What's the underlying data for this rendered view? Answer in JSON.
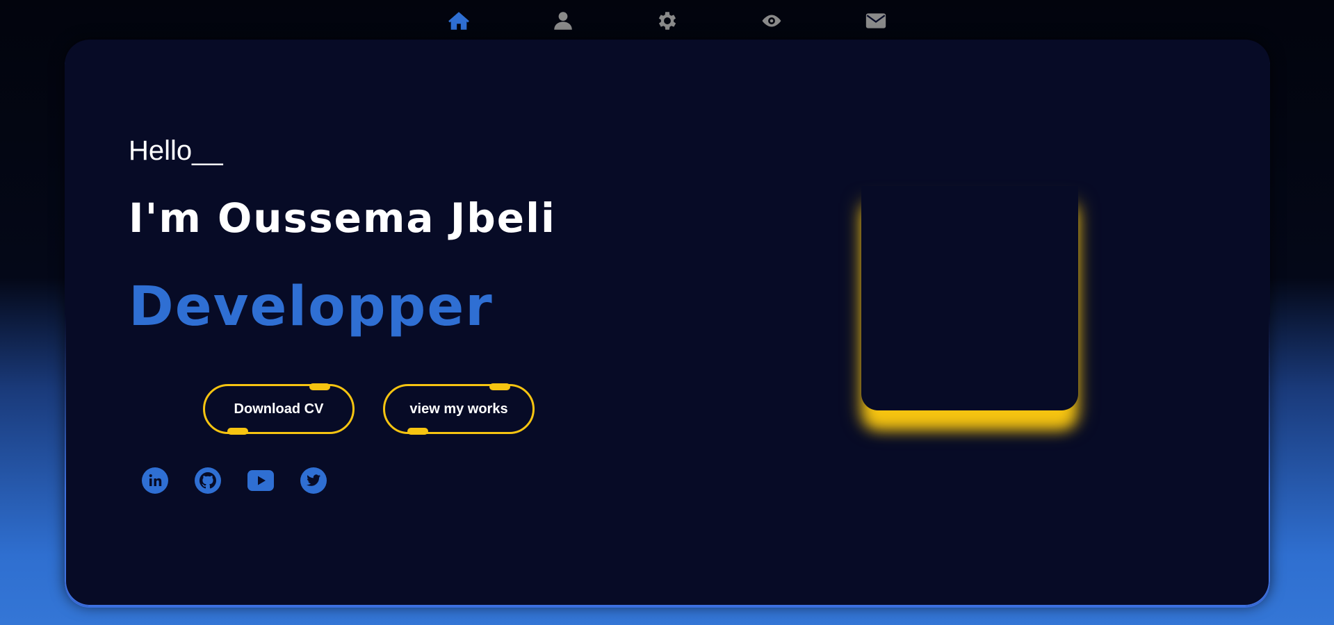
{
  "nav": {
    "items": [
      {
        "icon": "home-icon",
        "color": "#2f6fd3",
        "active": true
      },
      {
        "icon": "user-icon",
        "color": "#8a8a8a",
        "active": false
      },
      {
        "icon": "gear-icon",
        "color": "#8a8a8a",
        "active": false
      },
      {
        "icon": "eye-icon",
        "color": "#8a8a8a",
        "active": false
      },
      {
        "icon": "envelope-icon",
        "color": "#8a8a8a",
        "active": false
      }
    ]
  },
  "hero": {
    "greeting": "Hello__",
    "name": "I'm Oussema Jbeli",
    "role": "Developper"
  },
  "buttons": {
    "download_cv": "Download CV",
    "view_works": "view my works"
  },
  "socials": [
    {
      "icon": "linkedin-icon"
    },
    {
      "icon": "github-icon"
    },
    {
      "icon": "youtube-icon"
    },
    {
      "icon": "twitter-icon"
    }
  ],
  "colors": {
    "accent_blue": "#2f6fd3",
    "accent_yellow": "#f6c411",
    "card_bg": "#070b26",
    "nav_inactive": "#8a8a8a"
  }
}
